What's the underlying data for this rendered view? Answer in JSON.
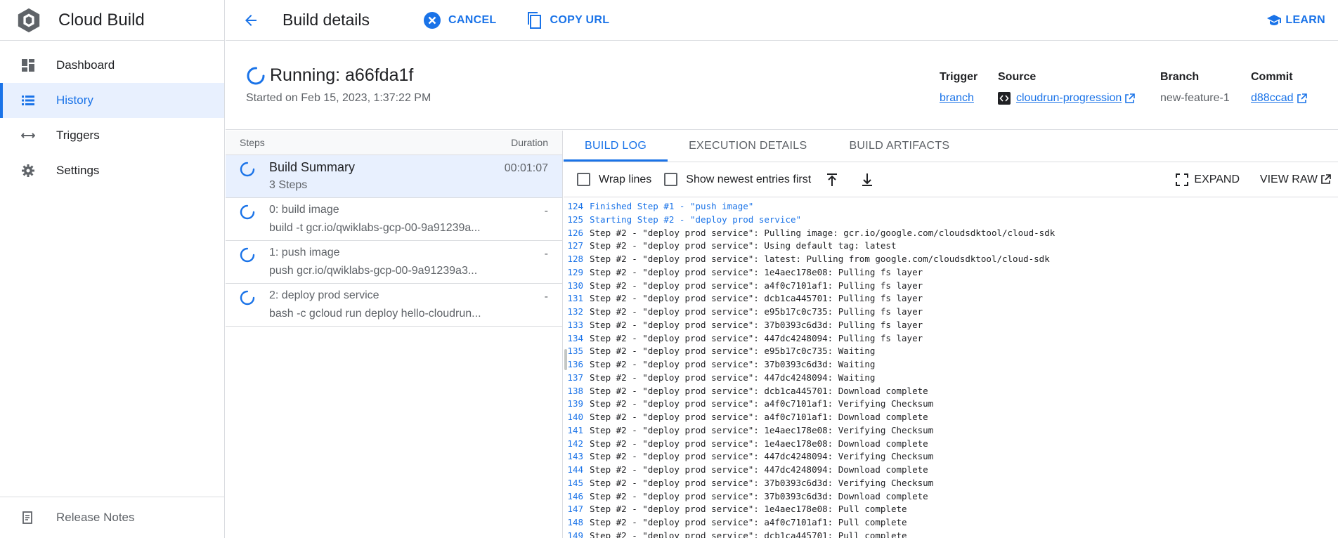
{
  "app": {
    "title": "Cloud Build"
  },
  "sidebar": {
    "items": [
      {
        "label": "Dashboard",
        "icon": "dashboard-icon"
      },
      {
        "label": "History",
        "icon": "list-icon",
        "active": true
      },
      {
        "label": "Triggers",
        "icon": "arrows-icon"
      },
      {
        "label": "Settings",
        "icon": "gear-icon"
      }
    ],
    "footer": {
      "label": "Release Notes",
      "icon": "notes-icon"
    }
  },
  "header": {
    "title": "Build details",
    "cancel_label": "CANCEL",
    "copy_label": "COPY URL",
    "learn_label": "LEARN"
  },
  "build": {
    "status_title": "Running: a66fda1f",
    "started": "Started on Feb 15, 2023, 1:37:22 PM",
    "trigger_label": "Trigger",
    "trigger_value": "branch",
    "source_label": "Source",
    "source_value": "cloudrun-progression",
    "branch_label": "Branch",
    "branch_value": "new-feature-1",
    "commit_label": "Commit",
    "commit_value": "d88ccad"
  },
  "steps": {
    "header_steps": "Steps",
    "header_duration": "Duration",
    "summary": {
      "name": "Build Summary",
      "sub": "3 Steps",
      "duration": "00:01:07"
    },
    "items": [
      {
        "name": "0: build image",
        "sub": "build -t gcr.io/qwiklabs-gcp-00-9a91239a...",
        "duration": "-"
      },
      {
        "name": "1: push image",
        "sub": "push gcr.io/qwiklabs-gcp-00-9a91239a3...",
        "duration": "-"
      },
      {
        "name": "2: deploy prod service",
        "sub": "bash -c gcloud run deploy hello-cloudrun...",
        "duration": "-"
      }
    ]
  },
  "tabs": [
    "BUILD LOG",
    "EXECUTION DETAILS",
    "BUILD ARTIFACTS"
  ],
  "toolbar": {
    "wrap_label": "Wrap lines",
    "newest_label": "Show newest entries first",
    "expand_label": "EXPAND",
    "raw_label": "VIEW RAW"
  },
  "log": [
    {
      "n": "124",
      "t": "Finished Step #1 - \"push image\"",
      "hl": true
    },
    {
      "n": "125",
      "t": "Starting Step #2 - \"deploy prod service\"",
      "hl": true
    },
    {
      "n": "126",
      "t": "Step #2 - \"deploy prod service\": Pulling image: gcr.io/google.com/cloudsdktool/cloud-sdk"
    },
    {
      "n": "127",
      "t": "Step #2 - \"deploy prod service\": Using default tag: latest"
    },
    {
      "n": "128",
      "t": "Step #2 - \"deploy prod service\": latest: Pulling from google.com/cloudsdktool/cloud-sdk"
    },
    {
      "n": "129",
      "t": "Step #2 - \"deploy prod service\": 1e4aec178e08: Pulling fs layer"
    },
    {
      "n": "130",
      "t": "Step #2 - \"deploy prod service\": a4f0c7101af1: Pulling fs layer"
    },
    {
      "n": "131",
      "t": "Step #2 - \"deploy prod service\": dcb1ca445701: Pulling fs layer"
    },
    {
      "n": "132",
      "t": "Step #2 - \"deploy prod service\": e95b17c0c735: Pulling fs layer"
    },
    {
      "n": "133",
      "t": "Step #2 - \"deploy prod service\": 37b0393c6d3d: Pulling fs layer"
    },
    {
      "n": "134",
      "t": "Step #2 - \"deploy prod service\": 447dc4248094: Pulling fs layer"
    },
    {
      "n": "135",
      "t": "Step #2 - \"deploy prod service\": e95b17c0c735: Waiting"
    },
    {
      "n": "136",
      "t": "Step #2 - \"deploy prod service\": 37b0393c6d3d: Waiting"
    },
    {
      "n": "137",
      "t": "Step #2 - \"deploy prod service\": 447dc4248094: Waiting"
    },
    {
      "n": "138",
      "t": "Step #2 - \"deploy prod service\": dcb1ca445701: Download complete"
    },
    {
      "n": "139",
      "t": "Step #2 - \"deploy prod service\": a4f0c7101af1: Verifying Checksum"
    },
    {
      "n": "140",
      "t": "Step #2 - \"deploy prod service\": a4f0c7101af1: Download complete"
    },
    {
      "n": "141",
      "t": "Step #2 - \"deploy prod service\": 1e4aec178e08: Verifying Checksum"
    },
    {
      "n": "142",
      "t": "Step #2 - \"deploy prod service\": 1e4aec178e08: Download complete"
    },
    {
      "n": "143",
      "t": "Step #2 - \"deploy prod service\": 447dc4248094: Verifying Checksum"
    },
    {
      "n": "144",
      "t": "Step #2 - \"deploy prod service\": 447dc4248094: Download complete"
    },
    {
      "n": "145",
      "t": "Step #2 - \"deploy prod service\": 37b0393c6d3d: Verifying Checksum"
    },
    {
      "n": "146",
      "t": "Step #2 - \"deploy prod service\": 37b0393c6d3d: Download complete"
    },
    {
      "n": "147",
      "t": "Step #2 - \"deploy prod service\": 1e4aec178e08: Pull complete"
    },
    {
      "n": "148",
      "t": "Step #2 - \"deploy prod service\": a4f0c7101af1: Pull complete"
    },
    {
      "n": "149",
      "t": "Step #2 - \"deploy prod service\": dcb1ca445701: Pull complete"
    }
  ],
  "colors": {
    "accent": "#1a73e8",
    "active_bg": "#e8f0fe",
    "border": "#dadce0"
  }
}
